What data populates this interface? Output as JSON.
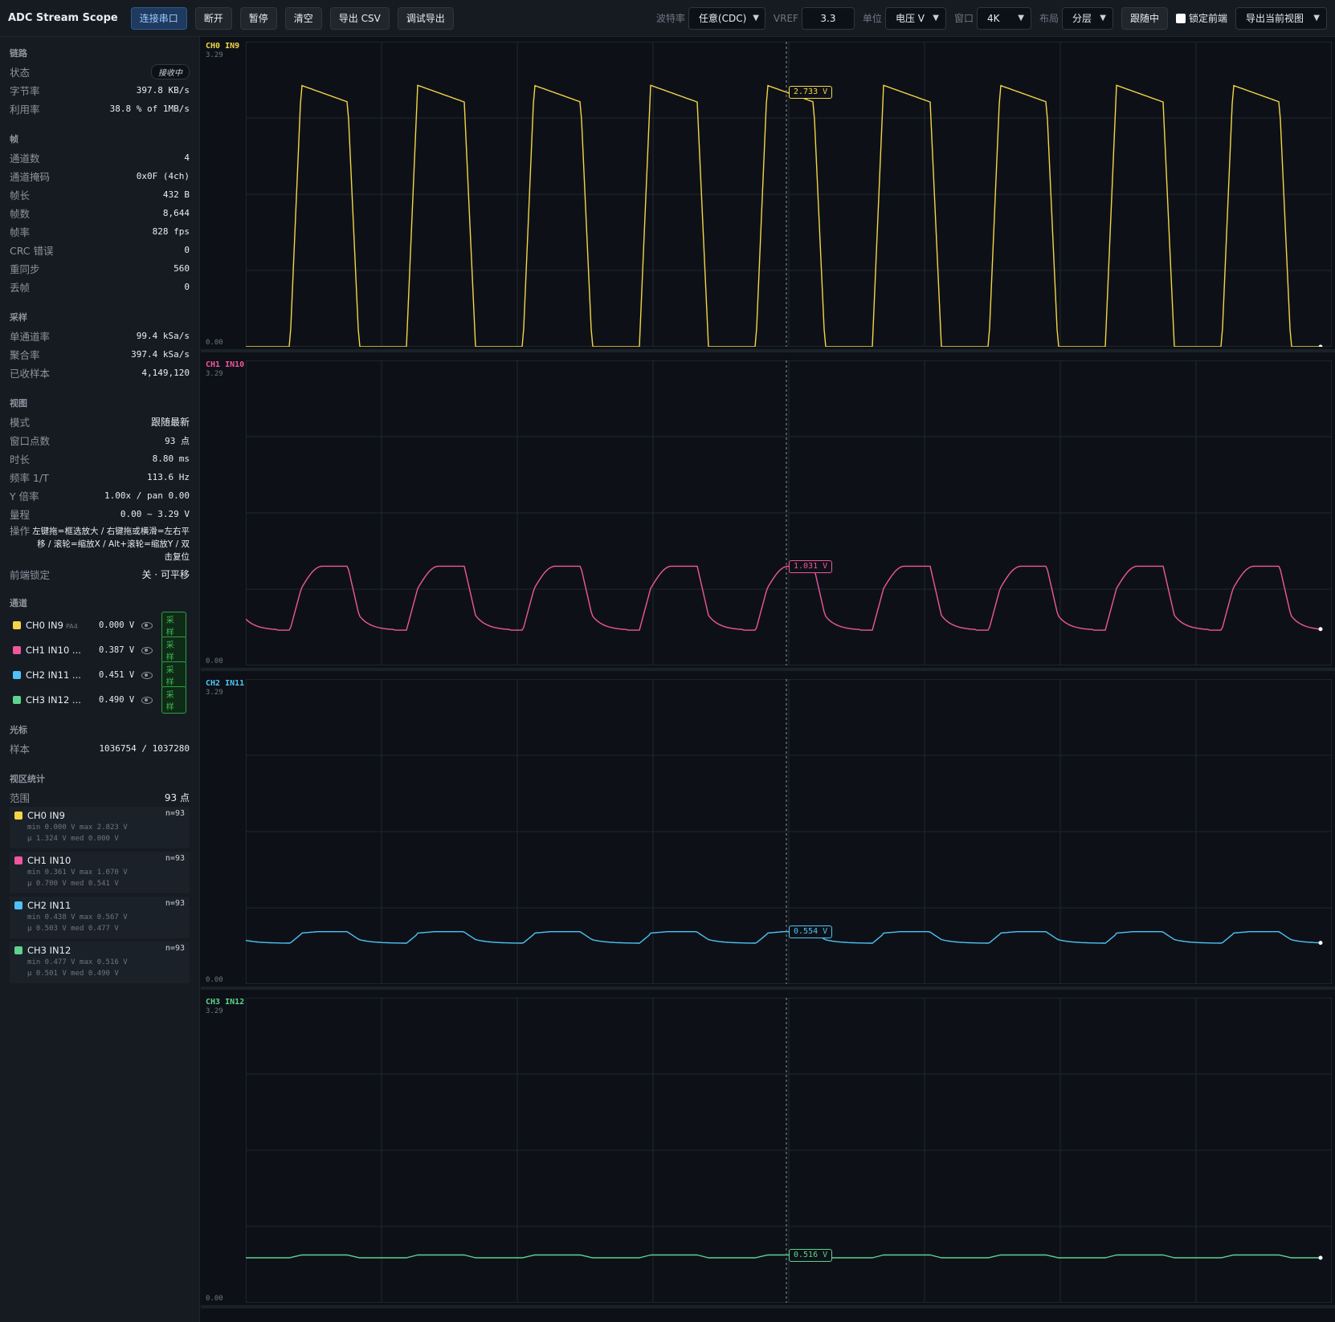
{
  "toolbar": {
    "title": "ADC Stream Scope",
    "buttons": [
      "连接串口",
      "断开",
      "暂停",
      "清空",
      "导出 CSV",
      "调试导出"
    ],
    "baud_label": "波特率",
    "baud_value": "任意(CDC)",
    "vref_label": "VREF",
    "vref_value": "3.3",
    "unit_label": "单位",
    "unit_value": "电压 V",
    "window_label": "窗口",
    "window_value": "4K",
    "layout_label": "布局",
    "layout_value": "分层",
    "follow_label": "跟随中",
    "lock_label": "锁定前端",
    "export_view": "导出当前视图"
  },
  "sidebar": {
    "link": {
      "title": "链路",
      "rows": [
        {
          "k": "状态",
          "v": "接收中"
        },
        {
          "k": "字节率",
          "v": "397.8 KB/s"
        },
        {
          "k": "利用率",
          "v": "38.8 % of 1MB/s"
        }
      ]
    },
    "frame": {
      "title": "帧",
      "rows": [
        {
          "k": "通道数",
          "v": "4"
        },
        {
          "k": "通道掩码",
          "v": "0x0F (4ch)"
        },
        {
          "k": "帧长",
          "v": "432 B"
        },
        {
          "k": "帧数",
          "v": "8,644"
        },
        {
          "k": "帧率",
          "v": "828 fps"
        },
        {
          "k": "CRC 错误",
          "v": "0"
        },
        {
          "k": "重同步",
          "v": "560"
        },
        {
          "k": "丢帧",
          "v": "0"
        }
      ]
    },
    "sampling": {
      "title": "采样",
      "rows": [
        {
          "k": "单通道率",
          "v": "99.4 kSa/s"
        },
        {
          "k": "聚合率",
          "v": "397.4 kSa/s"
        },
        {
          "k": "已收样本",
          "v": "4,149,120"
        }
      ]
    },
    "view": {
      "title": "视图",
      "rows": [
        {
          "k": "模式",
          "v": "跟随最新"
        },
        {
          "k": "窗口点数",
          "v": "93 点"
        },
        {
          "k": "时长",
          "v": "8.80 ms"
        },
        {
          "k": "频率 1/T",
          "v": "113.6 Hz"
        },
        {
          "k": "Y 倍率",
          "v": "1.00x / pan 0.00"
        },
        {
          "k": "量程",
          "v": "0.00 ~ 3.29 V"
        }
      ],
      "ops_k": "操作",
      "ops_v": "左键拖=框选放大 / 右键拖或横滑=左右平移 / 滚轮=缩放X / Alt+滚轮=缩放Y / 双击复位",
      "lock_k": "前端锁定",
      "lock_v": "关 · 可平移"
    },
    "channels": {
      "title": "通道",
      "sample_label": "采样",
      "items": [
        {
          "name": "CH0 IN9",
          "pin": "PA4",
          "value": "0.000 V",
          "color": "#f5d547"
        },
        {
          "name": "CH1 IN10 ...",
          "pin": "",
          "value": "0.387 V",
          "color": "#f0569e"
        },
        {
          "name": "CH2 IN11 ...",
          "pin": "",
          "value": "0.451 V",
          "color": "#4fc3f7"
        },
        {
          "name": "CH3 IN12 ...",
          "pin": "",
          "value": "0.490 V",
          "color": "#5fd38d"
        }
      ]
    },
    "cursor": {
      "title": "光标",
      "k": "样本",
      "v": "1036754 / 1037280"
    },
    "stats": {
      "title": "视区统计",
      "range_k": "范围",
      "range_v": "93 点",
      "items": [
        {
          "name": "CH0 IN9",
          "n": "n=93",
          "line1": "min 0.000 V max 2.823 V",
          "line2": "μ 1.324 V med 0.000 V",
          "color": "#f5d547"
        },
        {
          "name": "CH1 IN10",
          "n": "n=93",
          "line1": "min 0.361 V max 1.070 V",
          "line2": "μ 0.700 V med 0.541 V",
          "color": "#f0569e"
        },
        {
          "name": "CH2 IN11",
          "n": "n=93",
          "line1": "min 0.438 V max 0.567 V",
          "line2": "μ 0.503 V med 0.477 V",
          "color": "#4fc3f7"
        },
        {
          "name": "CH3 IN12",
          "n": "n=93",
          "line1": "min 0.477 V max 0.516 V",
          "line2": "μ 0.501 V med 0.490 V",
          "color": "#5fd38d"
        }
      ]
    }
  },
  "plots": {
    "ytop": "3.29",
    "ybot": "0.00",
    "panels": [
      {
        "label": "CH0 IN9",
        "color": "#f5d547",
        "cursor_value": "2.733 V"
      },
      {
        "label": "CH1 IN10",
        "color": "#f0569e",
        "cursor_value": "1.031 V"
      },
      {
        "label": "CH2 IN11",
        "color": "#4fc3f7",
        "cursor_value": "0.554 V"
      },
      {
        "label": "CH3 IN12",
        "color": "#5fd38d",
        "cursor_value": "0.516 V"
      }
    ]
  }
}
